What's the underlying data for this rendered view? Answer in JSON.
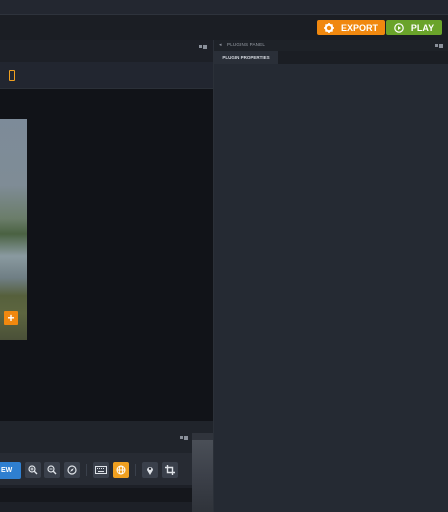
{
  "header": {
    "export_label": "EXPORT",
    "play_label": "PLAY",
    "export_icon": "gear-icon",
    "play_icon": "play-circle-icon"
  },
  "left_toolbar": {
    "device_icon": "mobile-phone-icon"
  },
  "canvas": {
    "add_label": "+"
  },
  "bottom_toolbar": {
    "preview_label": "EW",
    "tools": [
      "zoom-in-icon",
      "zoom-out-icon",
      "compass-icon",
      "keyboard-icon",
      "globe-icon",
      "map-pin-icon",
      "crop-icon"
    ],
    "active_tool": "globe-icon"
  },
  "right_panel": {
    "title": "PLUGINS PANEL",
    "tab_label": "PLUGIN PROPERTIES"
  },
  "colors": {
    "accent_orange": "#f0880f",
    "play_green": "#6aa32a",
    "preview_blue": "#2f7fd0",
    "active_tool": "#f0a020"
  }
}
